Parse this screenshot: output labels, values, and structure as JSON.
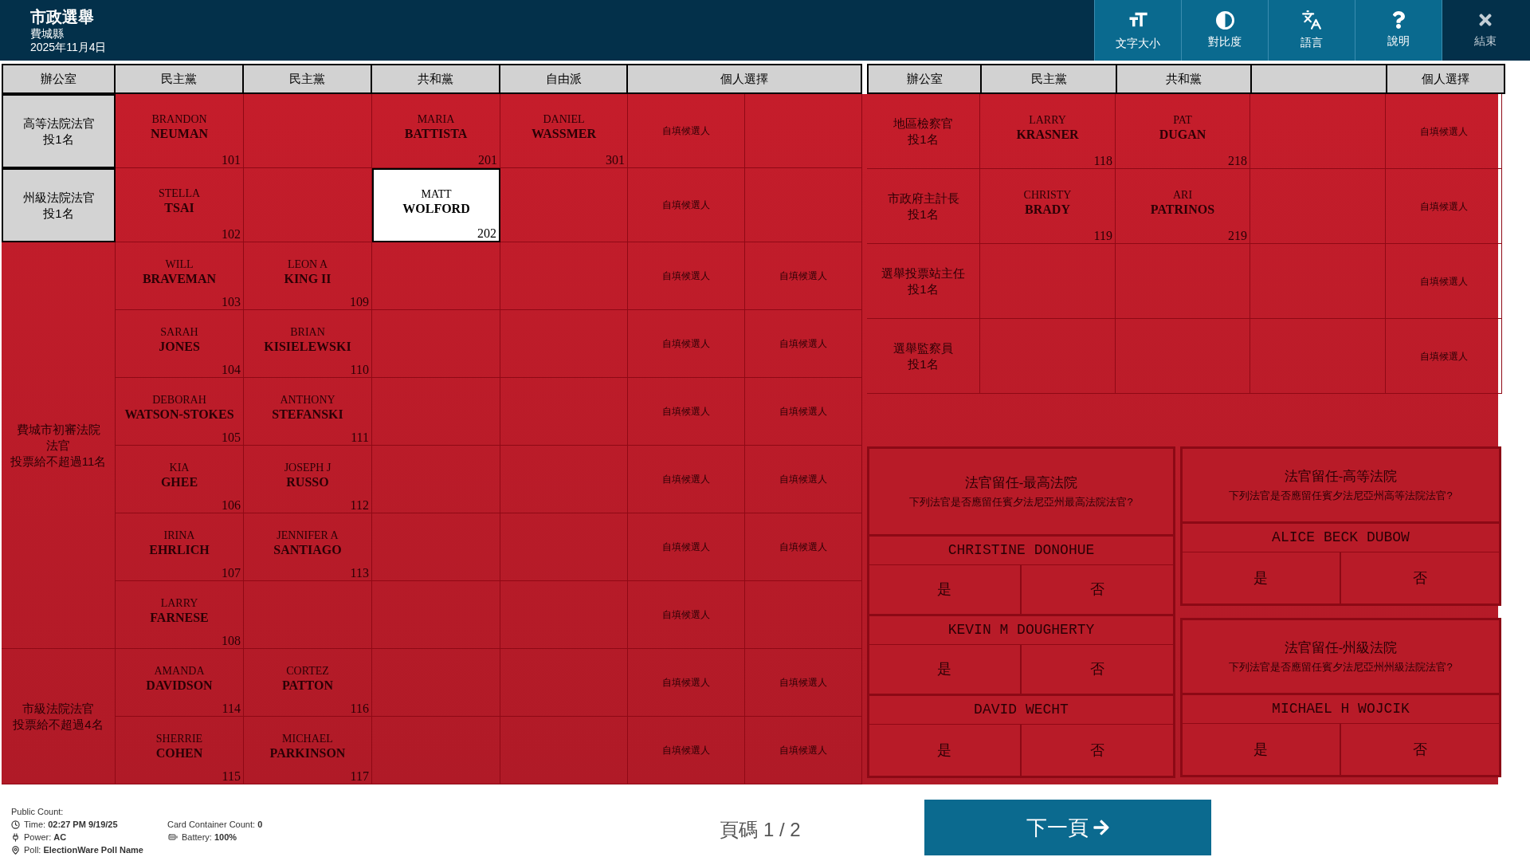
{
  "header": {
    "title": "市政選舉",
    "county": "費城縣",
    "date": "2025年11月4日"
  },
  "toolbar": [
    {
      "kind": "text-size",
      "label": "文字大小"
    },
    {
      "kind": "contrast",
      "label": "對比度"
    },
    {
      "kind": "language",
      "label": "語言"
    },
    {
      "kind": "help",
      "label": "說明"
    },
    {
      "kind": "exit",
      "label": "結束"
    }
  ],
  "left_table": {
    "columns": [
      "辦公室",
      "民主黨",
      "民主黨",
      "共和黨",
      "自由派",
      "個人選擇"
    ],
    "contests": [
      {
        "office": "高等法院法官",
        "limit": "投1名",
        "highlighted": false,
        "rows": [
          {
            "cells": [
              {
                "kind": "candidate",
                "first": "BRANDON",
                "last": "NEUMAN",
                "number": "101",
                "selected": false
              },
              {
                "kind": "empty"
              },
              {
                "kind": "candidate",
                "first": "MARIA",
                "last": "BATTISTA",
                "number": "201",
                "selected": false
              },
              {
                "kind": "candidate",
                "first": "DANIEL",
                "last": "WASSMER",
                "number": "301",
                "selected": false
              },
              {
                "kind": "write-in",
                "label": "自填候選人"
              },
              {
                "kind": "empty"
              }
            ]
          }
        ]
      },
      {
        "office": "州級法院法官",
        "limit": "投1名",
        "highlighted": false,
        "rows": [
          {
            "cells": [
              {
                "kind": "candidate",
                "first": "STELLA",
                "last": "TSAI",
                "number": "102",
                "selected": false
              },
              {
                "kind": "empty"
              },
              {
                "kind": "candidate",
                "first": "MATT",
                "last": "WOLFORD",
                "number": "202",
                "selected": true
              },
              {
                "kind": "empty"
              },
              {
                "kind": "write-in",
                "label": "自填候選人"
              },
              {
                "kind": "empty"
              }
            ]
          }
        ]
      },
      {
        "office": "費城市初審法院法官",
        "limit": "投票給不超過11名",
        "highlighted": true,
        "rows": [
          {
            "cells": [
              {
                "kind": "candidate",
                "first": "WILL",
                "last": "BRAVEMAN",
                "number": "103",
                "selected": false
              },
              {
                "kind": "candidate",
                "first": "LEON A",
                "last": "KING II",
                "number": "109",
                "selected": false
              },
              {
                "kind": "empty"
              },
              {
                "kind": "empty"
              },
              {
                "kind": "write-in",
                "label": "自填候選人"
              },
              {
                "kind": "write-in",
                "label": "自填候選人"
              }
            ]
          },
          {
            "cells": [
              {
                "kind": "candidate",
                "first": "SARAH",
                "last": "JONES",
                "number": "104",
                "selected": false
              },
              {
                "kind": "candidate",
                "first": "BRIAN",
                "last": "KISIELEWSKI",
                "number": "110",
                "selected": false
              },
              {
                "kind": "empty"
              },
              {
                "kind": "empty"
              },
              {
                "kind": "write-in",
                "label": "自填候選人"
              },
              {
                "kind": "write-in",
                "label": "自填候選人"
              }
            ]
          },
          {
            "cells": [
              {
                "kind": "candidate",
                "first": "DEBORAH",
                "last": "WATSON-STOKES",
                "number": "105",
                "selected": false
              },
              {
                "kind": "candidate",
                "first": "ANTHONY",
                "last": "STEFANSKI",
                "number": "111",
                "selected": false
              },
              {
                "kind": "empty"
              },
              {
                "kind": "empty"
              },
              {
                "kind": "write-in",
                "label": "自填候選人"
              },
              {
                "kind": "write-in",
                "label": "自填候選人"
              }
            ]
          },
          {
            "cells": [
              {
                "kind": "candidate",
                "first": "KIA",
                "last": "GHEE",
                "number": "106",
                "selected": false
              },
              {
                "kind": "candidate",
                "first": "JOSEPH J",
                "last": "RUSSO",
                "number": "112",
                "selected": false
              },
              {
                "kind": "empty"
              },
              {
                "kind": "empty"
              },
              {
                "kind": "write-in",
                "label": "自填候選人"
              },
              {
                "kind": "write-in",
                "label": "自填候選人"
              }
            ]
          },
          {
            "cells": [
              {
                "kind": "candidate",
                "first": "IRINA",
                "last": "EHRLICH",
                "number": "107",
                "selected": false
              },
              {
                "kind": "candidate",
                "first": "JENNIFER A",
                "last": "SANTIAGO",
                "number": "113",
                "selected": false
              },
              {
                "kind": "empty"
              },
              {
                "kind": "empty"
              },
              {
                "kind": "write-in",
                "label": "自填候選人"
              },
              {
                "kind": "write-in",
                "label": "自填候選人"
              }
            ]
          },
          {
            "cells": [
              {
                "kind": "candidate",
                "first": "LARRY",
                "last": "FARNESE",
                "number": "108",
                "selected": false
              },
              {
                "kind": "empty"
              },
              {
                "kind": "empty"
              },
              {
                "kind": "empty"
              },
              {
                "kind": "write-in",
                "label": "自填候選人"
              },
              {
                "kind": "empty"
              }
            ]
          }
        ]
      },
      {
        "office": "市級法院法官",
        "limit": "投票給不超過4名",
        "highlighted": true,
        "rows": [
          {
            "cells": [
              {
                "kind": "candidate",
                "first": "AMANDA",
                "last": "DAVIDSON",
                "number": "114",
                "selected": false
              },
              {
                "kind": "candidate",
                "first": "CORTEZ",
                "last": "PATTON",
                "number": "116",
                "selected": false
              },
              {
                "kind": "empty"
              },
              {
                "kind": "empty"
              },
              {
                "kind": "write-in",
                "label": "自填候選人"
              },
              {
                "kind": "write-in",
                "label": "自填候選人"
              }
            ]
          },
          {
            "cells": [
              {
                "kind": "candidate",
                "first": "SHERRIE",
                "last": "COHEN",
                "number": "115",
                "selected": false
              },
              {
                "kind": "candidate",
                "first": "MICHAEL",
                "last": "PARKINSON",
                "number": "117",
                "selected": false
              },
              {
                "kind": "empty"
              },
              {
                "kind": "empty"
              },
              {
                "kind": "write-in",
                "label": "自填候選人"
              },
              {
                "kind": "write-in",
                "label": "自填候選人"
              }
            ]
          }
        ]
      }
    ]
  },
  "right_table": {
    "columns": [
      {
        "kind": "heading",
        "label": "辦公室"
      },
      {
        "kind": "heading",
        "label": "民主黨"
      },
      {
        "kind": "heading",
        "label": "共和黨"
      },
      {
        "kind": "blank"
      },
      {
        "kind": "heading",
        "label": "個人選擇"
      }
    ],
    "contests": [
      {
        "office": "地區檢察官",
        "limit": "投1名",
        "highlighted": true,
        "rows": [
          {
            "cells": [
              {
                "kind": "candidate",
                "first": "LARRY",
                "last": "KRASNER",
                "number": "118",
                "selected": false
              },
              {
                "kind": "candidate",
                "first": "PAT",
                "last": "DUGAN",
                "number": "218",
                "selected": false
              },
              {
                "kind": "empty"
              },
              {
                "kind": "write-in",
                "label": "自填候選人"
              }
            ]
          }
        ]
      },
      {
        "office": "市政府主計長",
        "limit": "投1名",
        "highlighted": true,
        "rows": [
          {
            "cells": [
              {
                "kind": "candidate",
                "first": "CHRISTY",
                "last": "BRADY",
                "number": "119",
                "selected": false
              },
              {
                "kind": "candidate",
                "first": "ARI",
                "last": "PATRINOS",
                "number": "219",
                "selected": false
              },
              {
                "kind": "empty"
              },
              {
                "kind": "write-in",
                "label": "自填候選人"
              }
            ]
          }
        ]
      },
      {
        "office": "選舉投票站主任",
        "limit": "投1名",
        "highlighted": true,
        "rows": [
          {
            "cells": [
              {
                "kind": "empty"
              },
              {
                "kind": "empty"
              },
              {
                "kind": "empty"
              },
              {
                "kind": "write-in",
                "label": "自填候選人"
              }
            ]
          }
        ]
      },
      {
        "office": "選舉監察員",
        "limit": "投1名",
        "highlighted": true,
        "rows": [
          {
            "cells": [
              {
                "kind": "empty"
              },
              {
                "kind": "empty"
              },
              {
                "kind": "empty"
              },
              {
                "kind": "write-in",
                "label": "自填候選人"
              }
            ]
          }
        ]
      }
    ]
  },
  "retention": [
    {
      "title": "法官留任-最高法院",
      "question": "下列法官是否應留任賓夕法尼亞州最高法院法官?",
      "judges": [
        {
          "name": "CHRISTINE DONOHUE",
          "options": [
            "是",
            "否"
          ]
        },
        {
          "name": "KEVIN M DOUGHERTY",
          "options": [
            "是",
            "否"
          ]
        },
        {
          "name": "DAVID WECHT",
          "options": [
            "是",
            "否"
          ]
        }
      ]
    },
    {
      "title": "法官留任-高等法院",
      "question": "下列法官是否應留任賓夕法尼亞州高等法院法官?",
      "judges": [
        {
          "name": "ALICE BECK DUBOW",
          "options": [
            "是",
            "否"
          ]
        }
      ]
    },
    {
      "title": "法官留任-州級法院",
      "question": "下列法官是否應留任賓夕法尼亞州州級法院法官?",
      "judges": [
        {
          "name": "MICHAEL H WOJCIK",
          "options": [
            "是",
            "否"
          ]
        }
      ]
    }
  ],
  "status": {
    "heading": "Public Count:",
    "items": [
      {
        "kind": "time",
        "label": "Time:",
        "value": "02:27 PM 9/19/25"
      },
      {
        "kind": "card-count",
        "label": "Card Container Count:",
        "value": "0"
      },
      {
        "kind": "power",
        "label": "Power:",
        "value": "AC"
      },
      {
        "kind": "battery",
        "label": "Battery:",
        "value": "100%"
      },
      {
        "kind": "poll",
        "label": "Poll:",
        "value": "ElectionWare Poll Name"
      }
    ]
  },
  "page_indicator": "頁碼 1 / 2",
  "next_button": {
    "label": "下一頁"
  }
}
